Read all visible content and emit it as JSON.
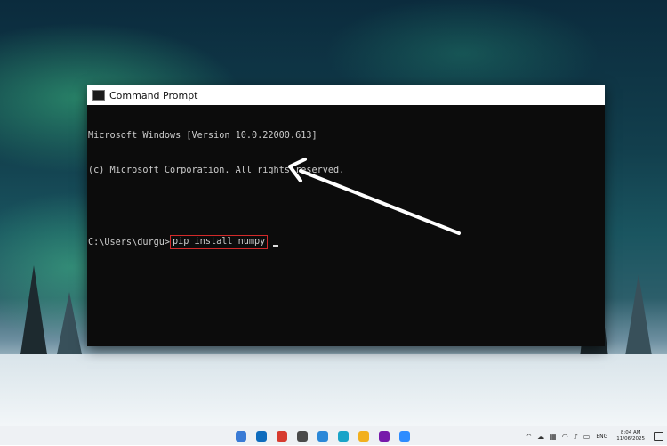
{
  "window": {
    "title": "Command Prompt"
  },
  "console": {
    "line1": "Microsoft Windows [Version 10.0.22000.613]",
    "line2": "(c) Microsoft Corporation. All rights reserved.",
    "prompt": "C:\\Users\\durgu>",
    "command": "pip install numpy"
  },
  "taskbar": {
    "apps": [
      {
        "name": "widgets",
        "color": "#3a7bd5"
      },
      {
        "name": "outlook",
        "color": "#0f6cbd"
      },
      {
        "name": "anydesk",
        "color": "#d73b2f"
      },
      {
        "name": "settings",
        "color": "#4a4a4a"
      },
      {
        "name": "photos",
        "color": "#2b88d8"
      },
      {
        "name": "edge",
        "color": "#1aa4c8"
      },
      {
        "name": "chrome",
        "color": "#f2b01e"
      },
      {
        "name": "onenote",
        "color": "#7719aa"
      },
      {
        "name": "zoom",
        "color": "#2d8cff"
      }
    ],
    "tray": {
      "lang": "ENG",
      "time": "8:04 AM",
      "date": "11/06/2025"
    }
  },
  "annotation": {
    "arrow_color": "#ffffff",
    "highlight_color": "#d32a2a"
  }
}
